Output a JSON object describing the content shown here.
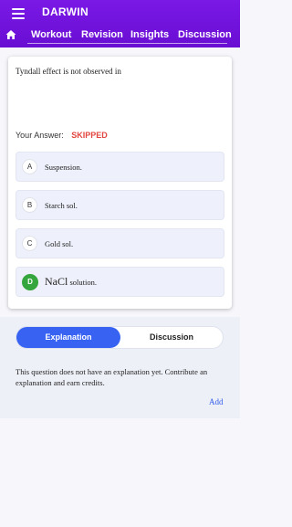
{
  "header": {
    "title": "DARWIN",
    "nav": [
      "Workout",
      "Revision",
      "Insights",
      "Discussion"
    ]
  },
  "question": {
    "text": "Tyndall effect is not observed in",
    "answer_label": "Your Answer:",
    "answer_status": "SKIPPED",
    "options": [
      {
        "letter": "A",
        "text": "Suspension."
      },
      {
        "letter": "B",
        "text": "Starch sol."
      },
      {
        "letter": "C",
        "text": "Gold sol."
      },
      {
        "letter": "D",
        "text_main": "NaCl",
        "text_rest": " solution.",
        "correct": true
      }
    ]
  },
  "explanation": {
    "tabs": [
      "Explanation",
      "Discussion"
    ],
    "active_tab": "Explanation",
    "text": "This question does not have an explanation yet. Contribute an explanation and earn credits.",
    "add_label": "Add"
  },
  "colors": {
    "header": "#7a18e6",
    "accent": "#3863f2",
    "skipped": "#e2453f",
    "correct": "#35a63d"
  },
  "icons": {
    "menu": "hamburger-icon",
    "home": "home-icon"
  }
}
